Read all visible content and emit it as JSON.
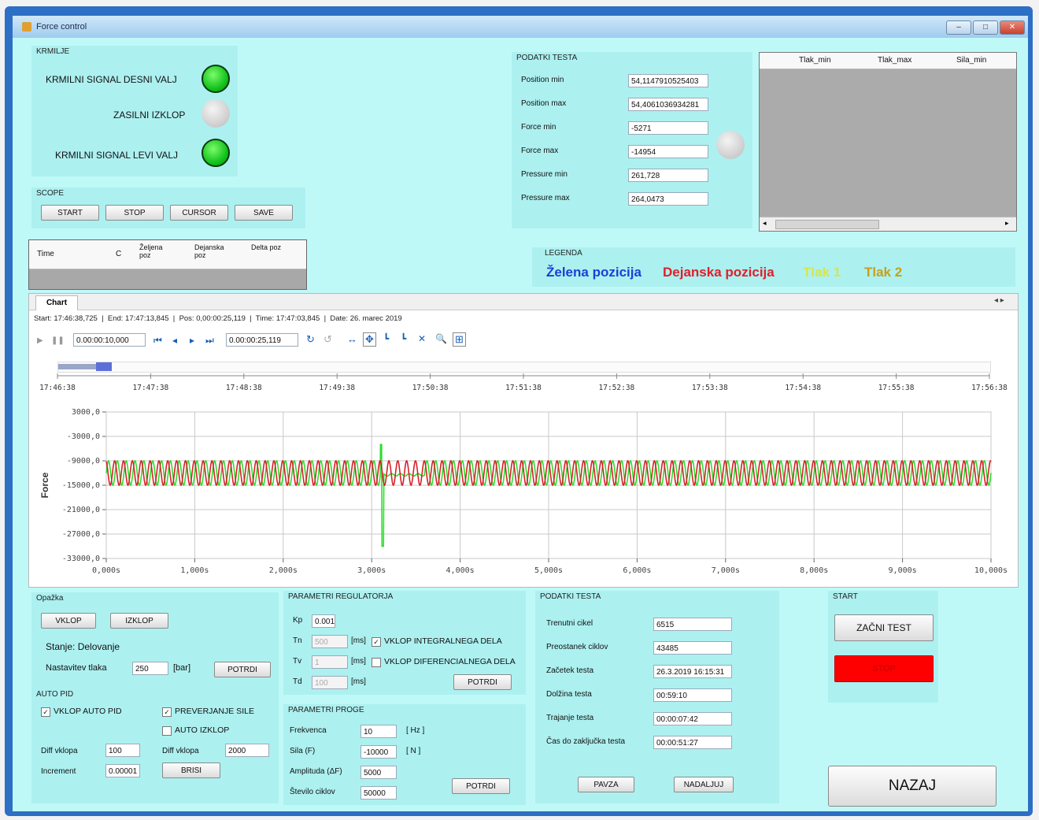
{
  "window": {
    "title": "Force control"
  },
  "krmilje": {
    "title": "KRMILJE",
    "signal_right": "KRMILNI SIGNAL DESNI VALJ",
    "emergency_stop": "ZASILNI IZKLOP",
    "signal_left": "KRMILNI SIGNAL LEVI VALJ"
  },
  "scope": {
    "title": "SCOPE",
    "start": "START",
    "stop": "STOP",
    "cursor": "CURSOR",
    "save": "SAVE"
  },
  "cursor_table": {
    "headers": [
      "Time",
      "C",
      "Željena poz",
      "Dejanska poz",
      "Delta poz"
    ]
  },
  "podatki_top": {
    "title": "PODATKI TESTA",
    "rows": [
      {
        "label": "Position min",
        "value": "54,1147910525403"
      },
      {
        "label": "Position max",
        "value": "54,4061036934281"
      },
      {
        "label": "Force min",
        "value": "-5271"
      },
      {
        "label": "Force max",
        "value": "-14954"
      },
      {
        "label": "Pressure min",
        "value": "261,728"
      },
      {
        "label": "Pressure max",
        "value": "264,0473"
      }
    ]
  },
  "grid_table": {
    "headers": [
      "Tlak_min",
      "Tlak_max",
      "Sila_min"
    ]
  },
  "legenda": {
    "title": "LEGENDA",
    "items": [
      {
        "label": "Želena pozicija",
        "color": "#1a3fd8"
      },
      {
        "label": "Dejanska pozicija",
        "color": "#e0202a"
      },
      {
        "label": "Tlak 1",
        "color": "#d6e64a"
      },
      {
        "label": "Tlak 2",
        "color": "#c8a018"
      }
    ]
  },
  "chart_panel": {
    "tab": "Chart",
    "status": {
      "start_label": "Start:",
      "start": "17:46:38,725",
      "end_label": "End:",
      "end": "17:47:13,845",
      "pos_label": "Pos:",
      "pos": "0,00:00:25,119",
      "time_label": "Time:",
      "time": "17:47:03,845",
      "date_label": "Date:",
      "date": "26. marec 2019"
    },
    "span_value": "0.00:00:10,000",
    "pos_value": "0.00:00:25,119",
    "overview_ticks": [
      "17:46:38",
      "17:47:38",
      "17:48:38",
      "17:49:38",
      "17:50:38",
      "17:51:38",
      "17:52:38",
      "17:53:38",
      "17:54:38",
      "17:55:38",
      "17:56:38"
    ]
  },
  "chart_data": {
    "type": "line",
    "ylabel": "Force",
    "yticks": [
      "3000,0",
      "-3000,0",
      "-9000,0",
      "-15000,0",
      "-21000,0",
      "-27000,0",
      "-33000,0"
    ],
    "ylim": [
      -33000,
      3000
    ],
    "xticks": [
      "0,000s",
      "1,000s",
      "2,000s",
      "3,000s",
      "4,000s",
      "5,000s",
      "6,000s",
      "7,000s",
      "8,000s",
      "9,000s",
      "10,000s"
    ],
    "xlim": [
      0,
      10
    ],
    "series": [
      {
        "color": "#2fdc2f",
        "amplitude_min": -15000,
        "amplitude_max": -9000,
        "frequency_hz": 10,
        "spike": {
          "x": 3.1,
          "min": -30000,
          "max": -5000
        }
      },
      {
        "color": "#d8202a",
        "amplitude_min": -15000,
        "amplitude_max": -9000,
        "frequency_hz": 10
      }
    ],
    "grid": true
  },
  "opazka": {
    "title": "Opažka",
    "vklop": "VKLOP",
    "izklop": "IZKLOP",
    "stanje": "Stanje: Delovanje",
    "nastavitev_label": "Nastavitev tlaka",
    "nastavitev_value": "250",
    "unit": "[bar]",
    "potrdi": "POTRDI"
  },
  "autopid": {
    "title": "AUTO PID",
    "vklop_auto": "VKLOP AUTO PID",
    "preverjanje": "PREVERJANJE SILE",
    "auto_izklop": "AUTO IZKLOP",
    "diff_vklopa_label": "Diff vklopa",
    "diff_vklopa_value": "100",
    "diff_vklopa2_label": "Diff vklopa",
    "diff_vklopa2_value": "2000",
    "increment_label": "Increment",
    "increment_value": "0.00001",
    "brisi": "BRISI"
  },
  "regulator": {
    "title": "PARAMETRI REGULATORJA",
    "kp_label": "Kp",
    "kp_value": "0.001",
    "tn_label": "Tn",
    "tn_value": "500",
    "tv_label": "Tv",
    "tv_value": "1",
    "td_label": "Td",
    "td_value": "100",
    "ms": "[ms]",
    "integral": "VKLOP INTEGRALNEGA DELA",
    "diferencial": "VKLOP DIFERENCIALNEGA DELA",
    "potrdi": "POTRDI"
  },
  "proga": {
    "title": "PARAMETRI PROGE",
    "frekvenca_label": "Frekvenca",
    "frekvenca_value": "10",
    "frekvenca_unit": "[ Hz ]",
    "sila_label": "Sila (F)",
    "sila_value": "-10000",
    "sila_unit": "[ N ]",
    "amplituda_label": "Amplituda (ΔF)",
    "amplituda_value": "5000",
    "stevilo_label": "Število ciklov",
    "stevilo_value": "50000",
    "potrdi": "POTRDI"
  },
  "podatki_bottom": {
    "title": "PODATKI TESTA",
    "rows": [
      {
        "label": "Trenutni cikel",
        "value": "6515"
      },
      {
        "label": "Preostanek ciklov",
        "value": "43485"
      },
      {
        "label": "Začetek testa",
        "value": "26.3.2019 16:15:31"
      },
      {
        "label": "Dolžina testa",
        "value": "00:59:10"
      },
      {
        "label": "Trajanje testa",
        "value": "00:00:07:42"
      },
      {
        "label": "Čas do zaključka testa",
        "value": "00:00:51:27"
      }
    ],
    "pavza": "PAVZA",
    "nadaljuj": "NADALJUJ"
  },
  "start_group": {
    "title": "START",
    "zacni": "ZAČNI TEST",
    "stop": "STOP",
    "stop_color": "#ff0000"
  },
  "nazaj": "NAZAJ"
}
